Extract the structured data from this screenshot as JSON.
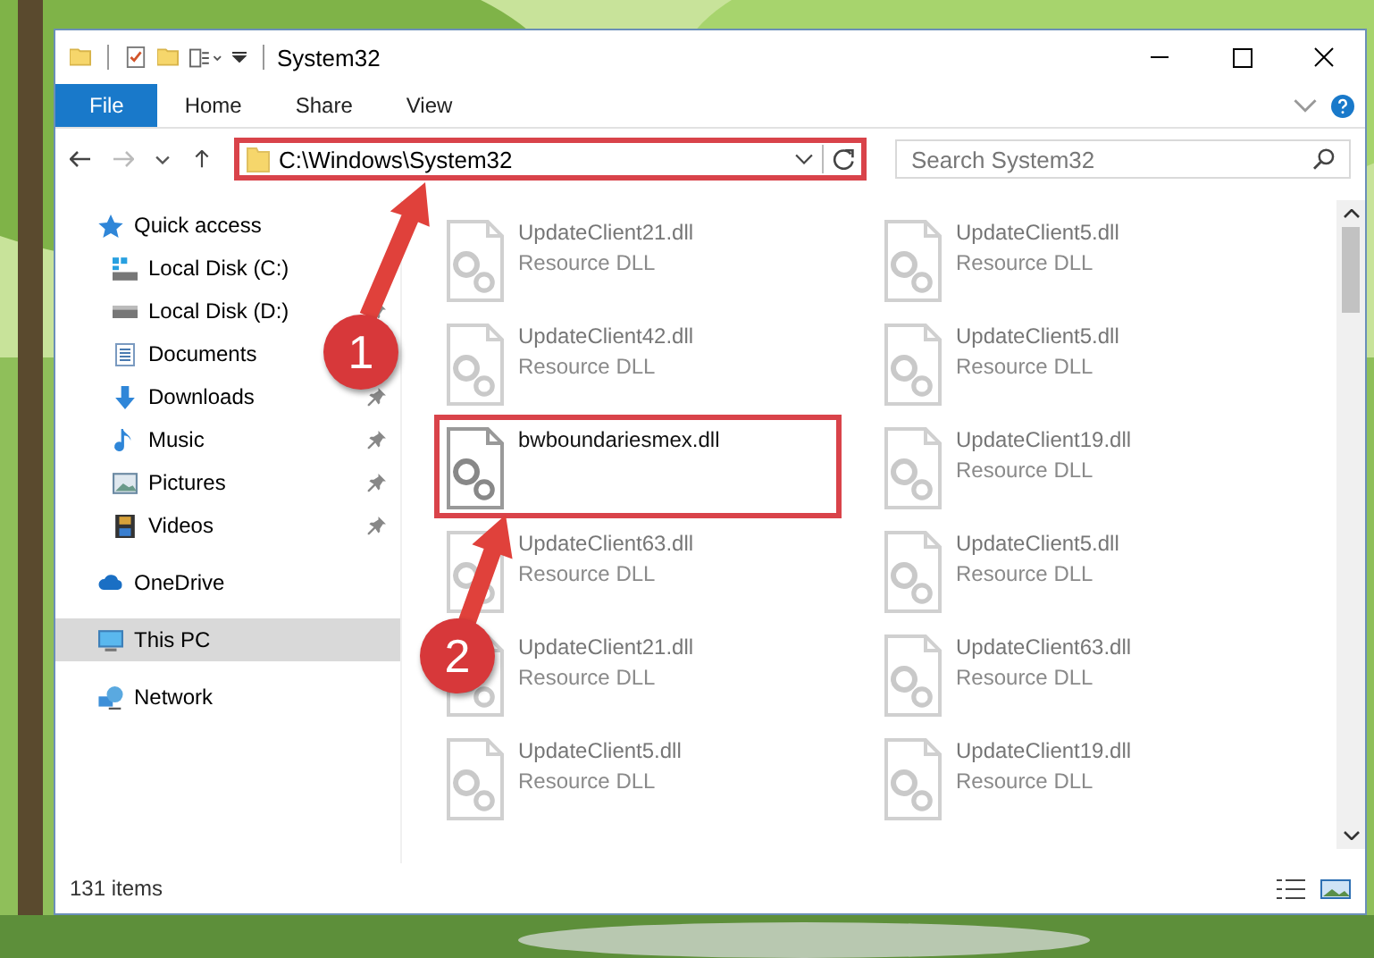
{
  "window": {
    "title": "System32"
  },
  "ribbon_tabs": [
    {
      "label": "File",
      "selected": true
    },
    {
      "label": "Home",
      "selected": false
    },
    {
      "label": "Share",
      "selected": false
    },
    {
      "label": "View",
      "selected": false
    }
  ],
  "address_bar": {
    "path": "C:\\Windows\\System32"
  },
  "search": {
    "placeholder": "Search System32"
  },
  "sidebar": {
    "items": [
      {
        "label": "Quick access",
        "selected": false,
        "children": [
          {
            "label": "Local Disk (C:)",
            "pinned": false,
            "selected": false
          },
          {
            "label": "Local Disk (D:)",
            "pinned": true,
            "selected": false
          },
          {
            "label": "Documents",
            "pinned": false,
            "selected": false
          },
          {
            "label": "Downloads",
            "pinned": true,
            "selected": false
          },
          {
            "label": "Music",
            "pinned": true,
            "selected": false
          },
          {
            "label": "Pictures",
            "pinned": true,
            "selected": false
          },
          {
            "label": "Videos",
            "pinned": true,
            "selected": false
          }
        ]
      },
      {
        "label": "OneDrive",
        "selected": false
      },
      {
        "label": "This PC",
        "selected": true
      },
      {
        "label": "Network",
        "selected": false
      }
    ]
  },
  "files": [
    {
      "name": "UpdateClient21.dll",
      "type": "Resource DLL",
      "dimmed": true,
      "marked": false
    },
    {
      "name": "UpdateClient5.dll",
      "type": "Resource DLL",
      "dimmed": true,
      "marked": false
    },
    {
      "name": "UpdateClient42.dll",
      "type": "Resource DLL",
      "dimmed": true,
      "marked": false
    },
    {
      "name": "UpdateClient5.dll",
      "type": "Resource DLL",
      "dimmed": true,
      "marked": false
    },
    {
      "name": "bwboundariesmex.dll",
      "dimmed": false,
      "marked": true
    },
    {
      "name": "UpdateClient19.dll",
      "type": "Resource DLL",
      "dimmed": true,
      "marked": false
    },
    {
      "name": "UpdateClient63.dll",
      "type": "Resource DLL",
      "dimmed": true,
      "marked": false
    },
    {
      "name": "UpdateClient5.dll",
      "type": "Resource DLL",
      "dimmed": true,
      "marked": false
    },
    {
      "name": "UpdateClient21.dll",
      "type": "Resource DLL",
      "dimmed": true,
      "marked": false
    },
    {
      "name": "UpdateClient63.dll",
      "type": "Resource DLL",
      "dimmed": true,
      "marked": false
    },
    {
      "name": "UpdateClient5.dll",
      "type": "Resource DLL",
      "dimmed": true,
      "marked": false
    },
    {
      "name": "UpdateClient19.dll",
      "type": "Resource DLL",
      "dimmed": true,
      "marked": false
    }
  ],
  "address_marked": true,
  "annotations": [
    {
      "label": "1"
    },
    {
      "label": "2"
    }
  ],
  "status_bar": {
    "count": "131 items"
  }
}
